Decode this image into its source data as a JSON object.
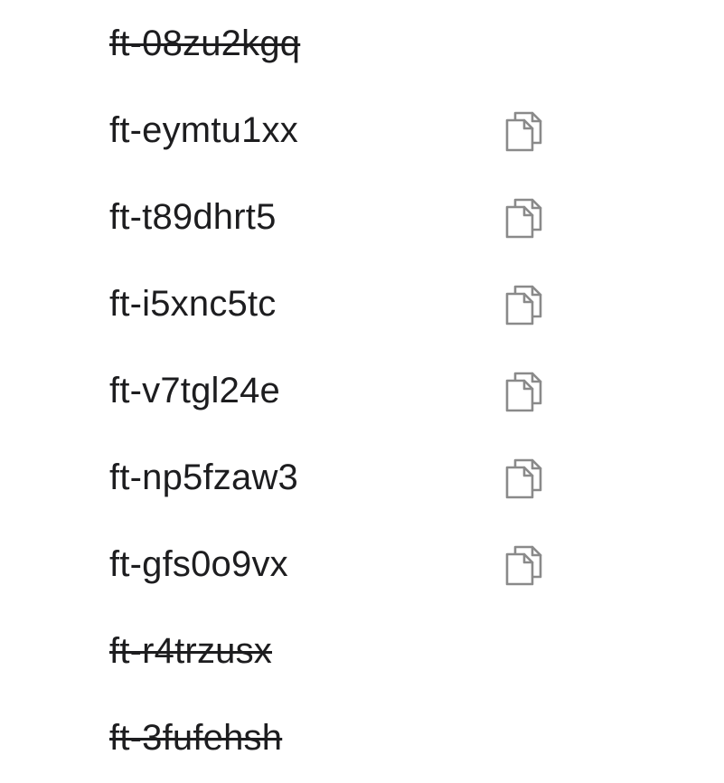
{
  "backup_codes": [
    {
      "code": "ft-08zu2kgq",
      "used": true
    },
    {
      "code": "ft-eymtu1xx",
      "used": false,
      "copy_icon": "copy-icon"
    },
    {
      "code": "ft-t89dhrt5",
      "used": false,
      "copy_icon": "copy-icon"
    },
    {
      "code": "ft-i5xnc5tc",
      "used": false,
      "copy_icon": "copy-icon"
    },
    {
      "code": "ft-v7tgl24e",
      "used": false,
      "copy_icon": "copy-icon"
    },
    {
      "code": "ft-np5fzaw3",
      "used": false,
      "copy_icon": "copy-icon"
    },
    {
      "code": "ft-gfs0o9vx",
      "used": false,
      "copy_icon": "copy-icon"
    },
    {
      "code": "ft-r4trzusx",
      "used": true
    },
    {
      "code": "ft-3fufehsh",
      "used": true
    }
  ],
  "colors": {
    "text": "#1d1d1f",
    "icon": "#8a8a8a",
    "background": "#ffffff"
  }
}
